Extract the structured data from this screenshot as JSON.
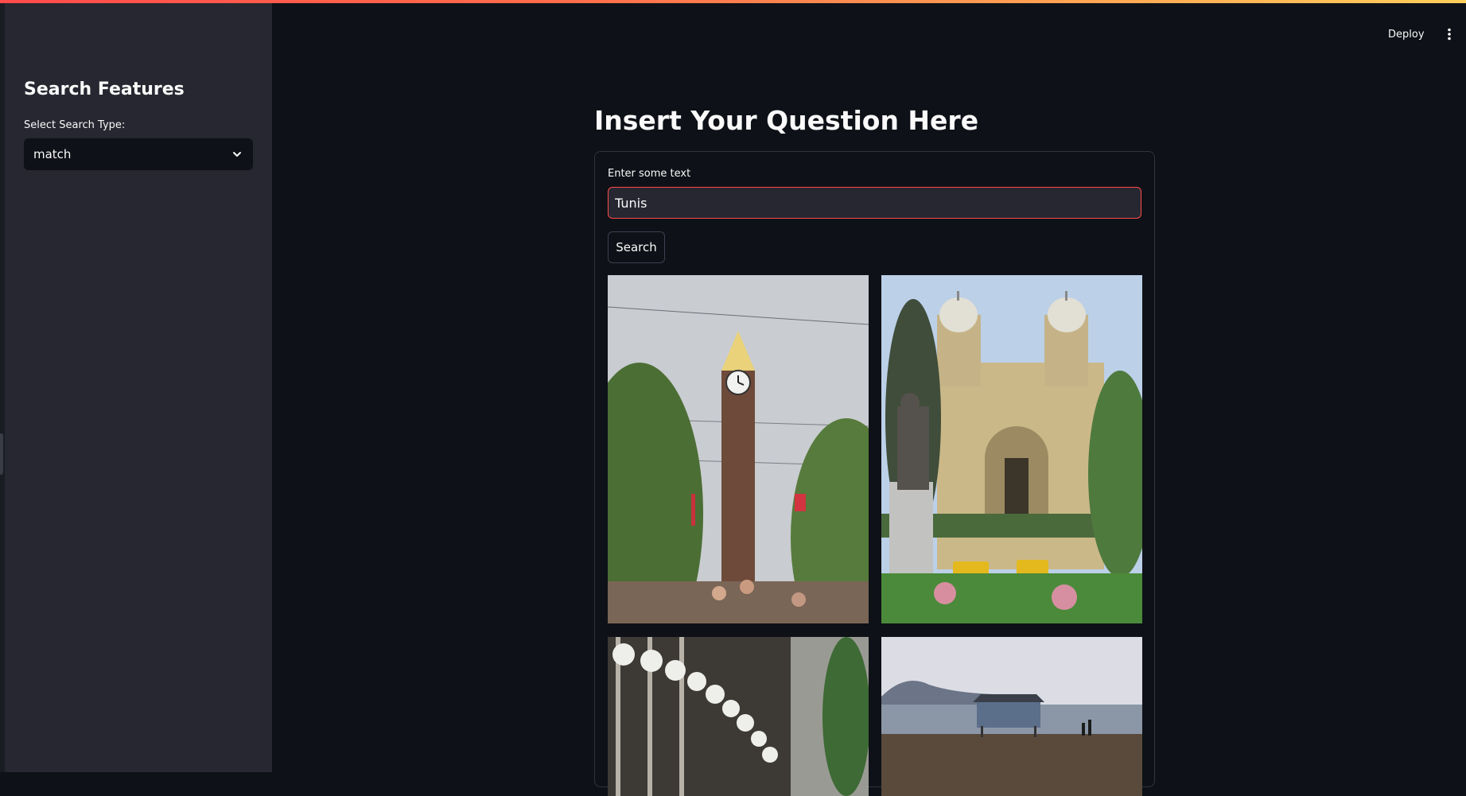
{
  "sidebar": {
    "title": "Search Features",
    "search_type_label": "Select Search Type:",
    "search_type_value": "match"
  },
  "header": {
    "deploy_label": "Deploy"
  },
  "main": {
    "title": "Insert Your Question Here",
    "input_label": "Enter some text",
    "input_value": "Tunis",
    "search_button_label": "Search",
    "results": [
      {
        "icon": "clock-tower-photo"
      },
      {
        "icon": "cathedral-photo"
      },
      {
        "icon": "street-lamps-photo"
      },
      {
        "icon": "beach-hut-photo"
      }
    ]
  },
  "colors": {
    "background": "#0e1117",
    "sidebar": "#262730",
    "accent": "#ff4b4b",
    "text": "#fafafa"
  }
}
